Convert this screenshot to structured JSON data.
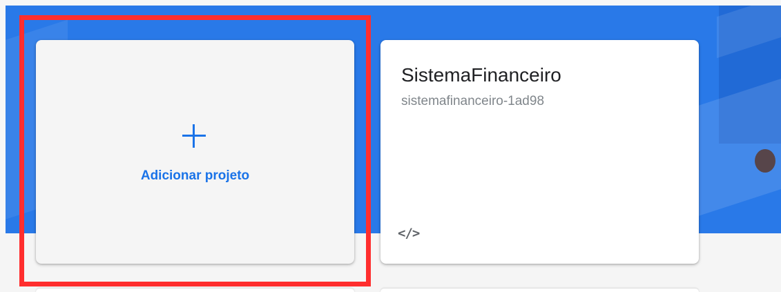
{
  "add_project": {
    "label": "Adicionar projeto",
    "icon": "plus-icon"
  },
  "project": {
    "name": "SistemaFinanceiro",
    "id": "sistemafinanceiro-1ad98",
    "platform_icon": "code-icon",
    "platform_symbol": "</>"
  },
  "colors": {
    "hero_background": "#2979e8",
    "accent": "#1a73e8",
    "highlight_border": "#ff2e2e",
    "add_card_background": "#f5f5f5",
    "project_card_background": "#ffffff"
  }
}
